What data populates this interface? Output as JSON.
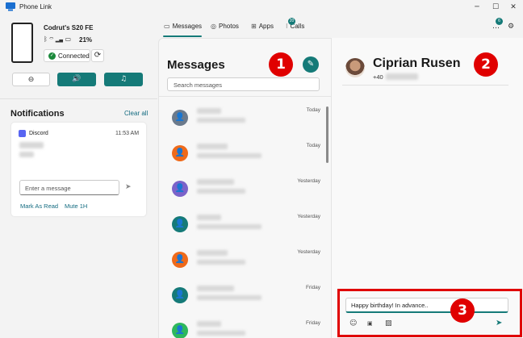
{
  "window": {
    "title": "Phone Link",
    "app_icon": "phone-link-logo-icon",
    "controls": [
      "minimize-icon",
      "maximize-icon",
      "close-icon"
    ]
  },
  "device": {
    "name": "Codrut's S20 FE",
    "battery": "21%",
    "status": "Connected",
    "status_icons": [
      "bluetooth-icon",
      "wifi-icon",
      "signal-icon",
      "battery-icon"
    ]
  },
  "quick_controls": [
    {
      "icon": "do-not-disturb-icon"
    },
    {
      "icon": "volume-icon"
    },
    {
      "icon": "music-icon"
    }
  ],
  "notifications": {
    "title": "Notifications",
    "clear_all": "Clear all",
    "items": [
      {
        "app": "Discord",
        "time": "11:53 AM",
        "input_placeholder": "Enter a message",
        "actions": [
          "Mark As Read",
          "Mute 1H"
        ]
      }
    ]
  },
  "nav": {
    "tabs": [
      {
        "label": "Messages",
        "icon": "chat-icon",
        "active": true
      },
      {
        "label": "Photos",
        "icon": "photos-icon",
        "active": false
      },
      {
        "label": "Apps",
        "icon": "apps-grid-icon",
        "active": false
      },
      {
        "label": "Calls",
        "icon": "dialpad-icon",
        "active": false,
        "badge": "20"
      }
    ],
    "notification_badge": "6"
  },
  "messages": {
    "title": "Messages",
    "search_placeholder": "Search messages",
    "conversations": [
      {
        "time": "Today",
        "avatar_color": "#6b7a8c"
      },
      {
        "time": "Today",
        "avatar_color": "#ef6a1a"
      },
      {
        "time": "Yesterday",
        "avatar_color": "#7b63c9"
      },
      {
        "time": "Yesterday",
        "avatar_color": "#157a78"
      },
      {
        "time": "Yesterday",
        "avatar_color": "#ef6a1a"
      },
      {
        "time": "Friday",
        "avatar_color": "#157a78"
      },
      {
        "time": "Friday",
        "avatar_color": "#2eb85c"
      }
    ]
  },
  "conversation": {
    "contact_name": "Ciprian Rusen",
    "contact_phone_prefix": "+40",
    "draft_text": "Happy birthday! In advance..",
    "toolbar_icons": [
      "emoji-icon",
      "gif-icon",
      "image-icon"
    ],
    "send_icon": "send-icon"
  },
  "annotations": {
    "markers": [
      "1",
      "2",
      "3"
    ],
    "color": "#e00000"
  },
  "colors": {
    "accent": "#157a78",
    "link": "#136b80"
  }
}
